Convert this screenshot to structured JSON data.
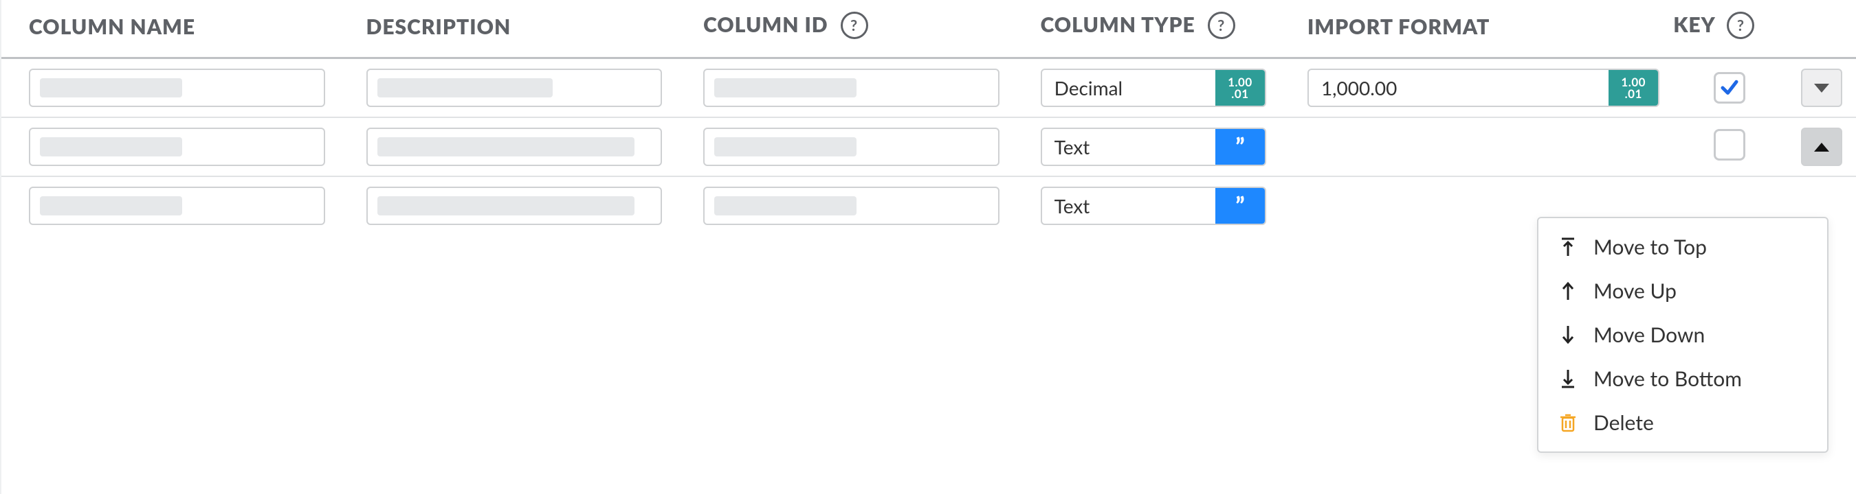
{
  "headers": {
    "column_name": "COLUMN NAME",
    "description": "DESCRIPTION",
    "column_id": "COLUMN ID",
    "column_type": "COLUMN TYPE",
    "import_format": "IMPORT FORMAT",
    "key": "KEY"
  },
  "badge_labels": {
    "decimal_top": "1.00",
    "decimal_bot": ".01"
  },
  "rows": [
    {
      "name": "",
      "description": "",
      "column_id": "",
      "type_label": "Decimal",
      "type_badge": "teal-decimal",
      "import_format_label": "1,000.00",
      "import_format_badge": "teal-decimal",
      "key_checked": true,
      "menu_open": false
    },
    {
      "name": "",
      "description": "",
      "column_id": "",
      "type_label": "Text",
      "type_badge": "blue-quotes",
      "import_format_label": "",
      "import_format_badge": "",
      "key_checked": false,
      "menu_open": true
    },
    {
      "name": "",
      "description": "",
      "column_id": "",
      "type_label": "Text",
      "type_badge": "blue-quotes",
      "import_format_label": "",
      "import_format_badge": "",
      "key_checked": null,
      "menu_open": false
    }
  ],
  "row_menu": {
    "move_top": "Move to Top",
    "move_up": "Move Up",
    "move_down": "Move Down",
    "move_bottom": "Move to Bottom",
    "delete": "Delete"
  }
}
